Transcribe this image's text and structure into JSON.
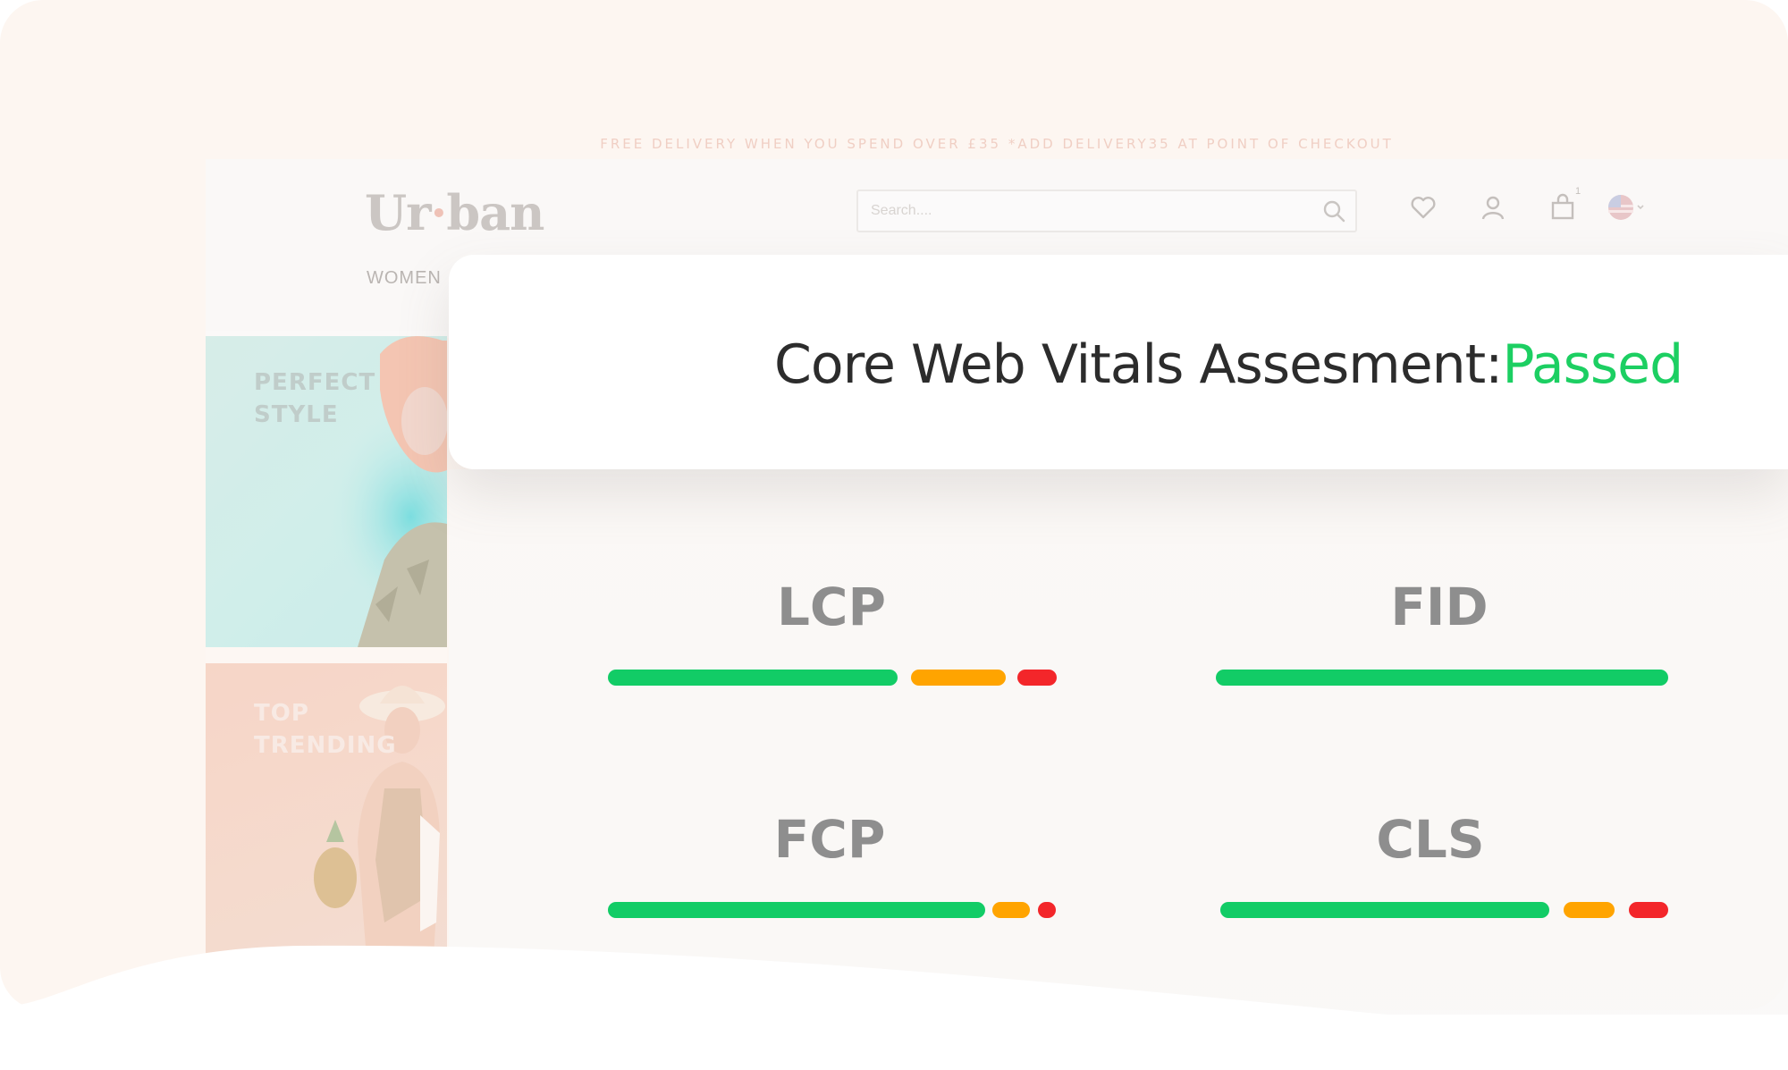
{
  "site": {
    "promo_text": "FREE DELIVERY WHEN YOU SPEND OVER £35 *ADD DELIVERY35 AT POINT OF CHECKOUT",
    "logo": {
      "part1": "Ur",
      "part2": "ban"
    },
    "search": {
      "placeholder": "Search...."
    },
    "cart_count": "1",
    "nav": {
      "women": "WOMEN"
    },
    "banners": [
      {
        "line1": "PERFECT",
        "line2": "STYLE"
      },
      {
        "line1": "TOP",
        "line2": "TRENDING"
      }
    ]
  },
  "assessment": {
    "title": "Core Web Vitals Assesment:",
    "status": "Passed",
    "status_color": "#1ccf62"
  },
  "metrics": [
    {
      "label": "LCP",
      "good": 0.65,
      "needs_improvement": 0.24,
      "poor": 0.08
    },
    {
      "label": "FID",
      "good": 1.0,
      "needs_improvement": 0.0,
      "poor": 0.0
    },
    {
      "label": "FCP",
      "good": 0.84,
      "needs_improvement": 0.08,
      "poor": 0.04
    },
    {
      "label": "CLS",
      "good": 0.74,
      "needs_improvement": 0.11,
      "poor": 0.09
    }
  ],
  "colors": {
    "good": "#12cc66",
    "needs_improvement": "#ffa400",
    "poor": "#f3262a"
  }
}
